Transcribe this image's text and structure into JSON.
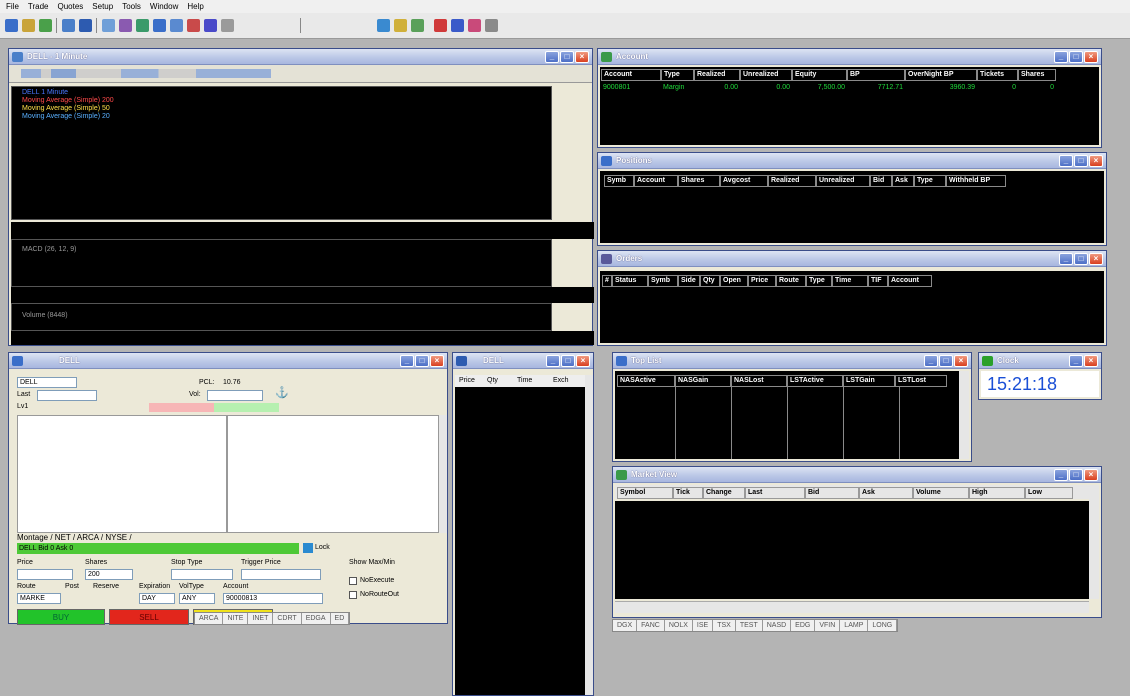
{
  "menu": [
    "File",
    "Trade",
    "Quotes",
    "Setup",
    "Tools",
    "Window",
    "Help"
  ],
  "chart_win": {
    "title": "DELL - 1 Minute",
    "legend": [
      {
        "text": "DELL 1 Minute",
        "color": "#4a78ff"
      },
      {
        "text": "Moving Average (Simple) 200",
        "color": "#ff4a4a"
      },
      {
        "text": "Moving Average (Simple) 50",
        "color": "#ffe14a"
      },
      {
        "text": "Moving Average (Simple) 20",
        "color": "#5ab0ff"
      }
    ],
    "macd_label": "MACD (26, 12, 9)",
    "volume_label": "Volume (8448)"
  },
  "account_win": {
    "title": "Account",
    "columns": [
      "Account",
      "Type",
      "Realized",
      "Unrealized",
      "Equity",
      "BP",
      "OverNight BP",
      "Tickets",
      "Shares"
    ],
    "row": [
      "9000801",
      "Margin",
      "0.00",
      "0.00",
      "7,500.00",
      "7712.71",
      "3960.39",
      "0",
      "0"
    ]
  },
  "positions_win": {
    "title": "Positions",
    "columns": [
      "Symb",
      "Account",
      "Shares",
      "Avgcost",
      "Realized",
      "Unrealized",
      "Bid",
      "Ask",
      "Type",
      "Withheld BP"
    ]
  },
  "orders_win": {
    "title": "Orders",
    "columns": [
      "#",
      "Status",
      "Symb",
      "Side",
      "Qty",
      "Open",
      "Price",
      "Route",
      "Type",
      "Time",
      "TIF",
      "Account"
    ]
  },
  "montage_win": {
    "title": "DELL",
    "symbol": "DELL",
    "pcl_label": "PCL:",
    "pcl_value": "10.76",
    "vol_label": "Vol:",
    "last_label": "Last",
    "lvl1_label": "Lv1",
    "tabs": "Montage / NET / ARCA / NYSE /",
    "bidask": "DELL Bid 0 Ask 0",
    "lock_label": "Lock",
    "price_label": "Price",
    "shares_label": "Shares",
    "shares_value": "200",
    "stop_label": "Stop Type",
    "trigger_label": "Trigger Price",
    "showmax_label": "Show Max/Min",
    "route_label": "Route",
    "post_label": "Post",
    "reserve_label": "Reserve",
    "exp_label": "Expiration",
    "voltype_label": "VolType",
    "account_label": "Account",
    "route_value": "MARKE",
    "exp_value": "DAY",
    "voltype_value": "ANY",
    "account_value": "90000813",
    "noexec_label": "NoExecute",
    "noroute_label": "NoRouteOut",
    "buy": "BUY",
    "sell": "SELL"
  },
  "ts_win": {
    "title": "DELL",
    "columns": [
      "Price",
      "Qty",
      "Time",
      "Exch"
    ]
  },
  "toplist_win": {
    "title": "Top List",
    "columns": [
      "NASActive",
      "NASGain",
      "NASLost",
      "LSTActive",
      "LSTGain",
      "LSTLost"
    ]
  },
  "clock_win": {
    "title": "Clock",
    "time": "15:21:18"
  },
  "market_win": {
    "title": "Market View",
    "columns": [
      "Symbol",
      "Tick",
      "Change",
      "Last",
      "Bid",
      "Ask",
      "Volume",
      "High",
      "Low"
    ]
  },
  "exchanges_left": [
    "ARCA",
    "NITE",
    "INET",
    "CDRT",
    "EDGA",
    "ED"
  ],
  "exchanges_right": [
    "DGX",
    "FANC",
    "NOLX",
    "ISE",
    "TSX",
    "TEST",
    "NASD",
    "EDG",
    "VFIN",
    "LAMP",
    "LONG"
  ],
  "colors": {
    "buy": "#22c32a",
    "sell": "#e2261c",
    "clock": "#1a4fd6",
    "bidbar": "#4ec937"
  }
}
